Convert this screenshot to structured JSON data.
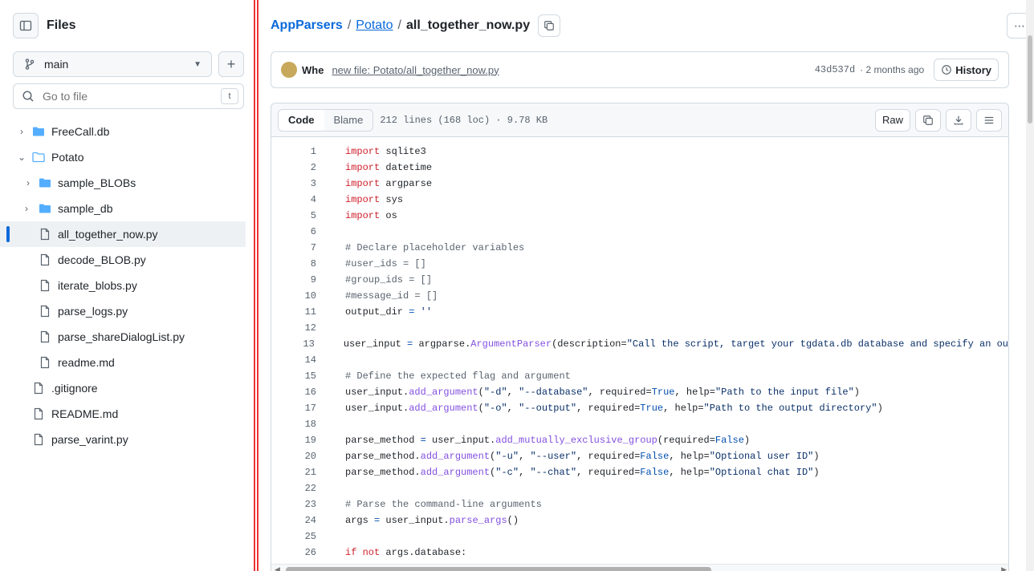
{
  "sidebar": {
    "title": "Files",
    "branch": "main",
    "goto_placeholder": "Go to file",
    "goto_kbd": "t",
    "items": [
      {
        "label": "FreeCall.db",
        "kind": "folder"
      },
      {
        "label": "Potato",
        "kind": "folder-open"
      },
      {
        "label": "sample_BLOBs",
        "kind": "folder"
      },
      {
        "label": "sample_db",
        "kind": "folder"
      },
      {
        "label": "all_together_now.py",
        "kind": "file"
      },
      {
        "label": "decode_BLOB.py",
        "kind": "file"
      },
      {
        "label": "iterate_blobs.py",
        "kind": "file"
      },
      {
        "label": "parse_logs.py",
        "kind": "file"
      },
      {
        "label": "parse_shareDialogList.py",
        "kind": "file"
      },
      {
        "label": "readme.md",
        "kind": "file"
      },
      {
        "label": ".gitignore",
        "kind": "file"
      },
      {
        "label": "README.md",
        "kind": "file"
      },
      {
        "label": "parse_varint.py",
        "kind": "file"
      }
    ]
  },
  "breadcrumb": {
    "repo": "AppParsers",
    "folder": "Potato",
    "file": "all_together_now.py"
  },
  "commit": {
    "author": "Whe",
    "message": "new file: Potato/all_together_now.py",
    "sha": "43d537d",
    "age": "· 2 months ago",
    "history_label": "History"
  },
  "code_header": {
    "code_tab": "Code",
    "blame_tab": "Blame",
    "meta": "212 lines (168 loc) · 9.78 KB",
    "raw_label": "Raw"
  },
  "code_lines": [
    "1",
    "2",
    "3",
    "4",
    "5",
    "6",
    "7",
    "8",
    "9",
    "10",
    "11",
    "12",
    "13",
    "14",
    "15",
    "16",
    "17",
    "18",
    "19",
    "20",
    "21",
    "22",
    "23",
    "24",
    "25",
    "26"
  ],
  "code_text": {
    "l1": "sqlite3",
    "l2": "datetime",
    "l3": "argparse",
    "l4": "sys",
    "l5": "os",
    "l7": "# Declare placeholder variables",
    "l8": "#user_ids = []",
    "l9": "#group_ids = []",
    "l10": "#message_id = []",
    "l11a": "output_dir",
    "l11b": "''",
    "l13a": "user_input",
    "l13b": "argparse.",
    "l13c": "ArgumentParser",
    "l13d": "(description=",
    "l13e": "\"Call the script, target your tgdata.db database and specify an ou",
    "l15": "# Define the expected flag and argument",
    "l16": "user_input.",
    "l19a": "parse_method",
    "l19b": "user_input.",
    "l19c": "add_mutually_exclusive_group",
    "l20": "parse_method.",
    "l23": "# Parse the command-line arguments",
    "l24a": "args",
    "l24b": "user_input.",
    "l24c": "parse_args",
    "l26": "args.database:"
  },
  "keywords": {
    "import": "import",
    "true": "True",
    "false": "False",
    "if": "if",
    "not": "not",
    "add_argument": "add_argument",
    "required": "required=",
    "help": "help="
  },
  "args": {
    "d": "\"-d\"",
    "database": "\"--database\"",
    "help_in": "\"Path to the input file\"",
    "o": "\"-o\"",
    "output": "\"--output\"",
    "help_out": "\"Path to the output directory\"",
    "u": "\"-u\"",
    "user": "\"--user\"",
    "help_user": "\"Optional user ID\"",
    "c": "\"-c\"",
    "chat": "\"--chat\"",
    "help_chat": "\"Optional chat ID\""
  },
  "colors": {
    "accent": "#0969da",
    "keyword": "#cf222e",
    "function": "#8250df",
    "string": "#0a3069"
  }
}
